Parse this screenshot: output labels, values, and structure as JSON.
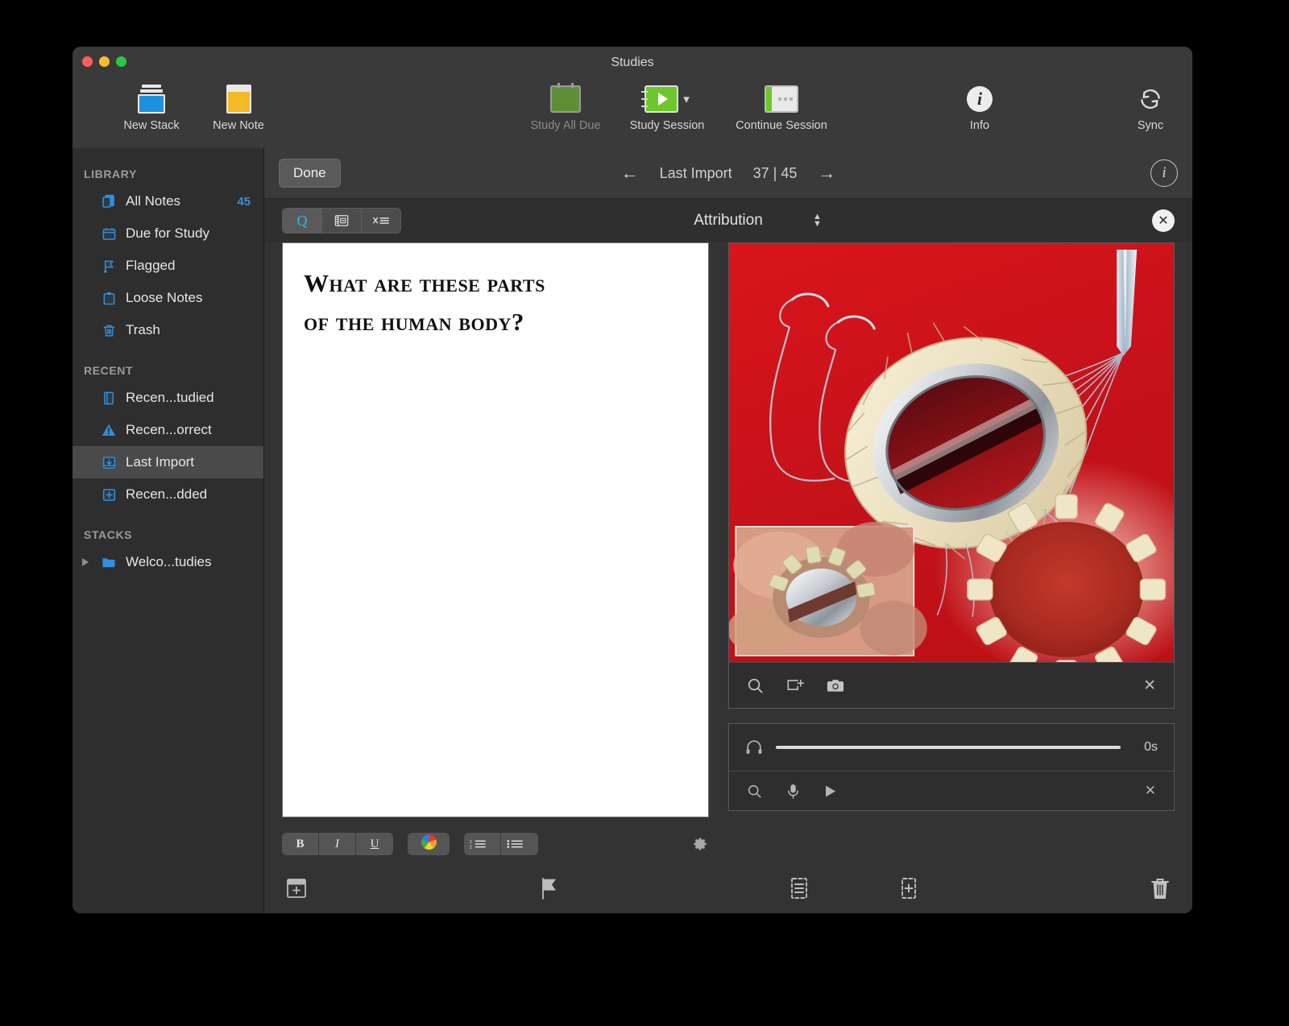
{
  "window": {
    "title": "Studies"
  },
  "toolbar": {
    "items": [
      {
        "label": "New Stack",
        "icon": "new-stack-icon",
        "dim": false
      },
      {
        "label": "New Note",
        "icon": "new-note-icon",
        "dim": false
      },
      {
        "label": "Study All Due",
        "icon": "calendar-icon",
        "dim": true
      },
      {
        "label": "Study Session",
        "icon": "play-notebook-icon",
        "dim": false
      },
      {
        "label": "Continue Session",
        "icon": "continue-notebook-icon",
        "dim": false
      },
      {
        "label": "Info",
        "icon": "info-circle-icon",
        "dim": false
      },
      {
        "label": "Sync",
        "icon": "sync-icon",
        "dim": false
      }
    ]
  },
  "sidebar": {
    "sections": [
      {
        "title": "LIBRARY",
        "items": [
          {
            "label": "All Notes",
            "icon": "notes-icon",
            "count": "45",
            "selected": false
          },
          {
            "label": "Due for Study",
            "icon": "calendar-icon",
            "count": "",
            "selected": false
          },
          {
            "label": "Flagged",
            "icon": "flag-icon",
            "count": "",
            "selected": false
          },
          {
            "label": "Loose Notes",
            "icon": "clipboard-icon",
            "count": "",
            "selected": false
          },
          {
            "label": "Trash",
            "icon": "trash-icon",
            "count": "",
            "selected": false
          }
        ]
      },
      {
        "title": "RECENT",
        "items": [
          {
            "label": "Recen...tudied",
            "icon": "recently-studied-icon",
            "count": "",
            "selected": false
          },
          {
            "label": "Recen...orrect",
            "icon": "warning-triangle-icon",
            "count": "",
            "selected": false
          },
          {
            "label": "Last Import",
            "icon": "import-icon",
            "count": "",
            "selected": true
          },
          {
            "label": "Recen...dded",
            "icon": "plus-box-icon",
            "count": "",
            "selected": false
          }
        ]
      },
      {
        "title": "STACKS",
        "items": [
          {
            "label": "Welco...tudies",
            "icon": "folder-icon",
            "count": "",
            "selected": false,
            "disclosure": true
          }
        ]
      }
    ]
  },
  "navbar": {
    "done_label": "Done",
    "prev_arrow": "←",
    "next_arrow": "→",
    "source_label": "Last Import",
    "position": "37 | 45",
    "info_glyph": "i"
  },
  "attribution": {
    "segments": [
      {
        "label": "Q",
        "name": "question-tab",
        "active": true
      },
      {
        "label": "",
        "name": "card-layout-tab",
        "active": false
      },
      {
        "label": "",
        "name": "multiply-list-tab",
        "active": false
      }
    ],
    "title": "Attribution",
    "close_glyph": "✕"
  },
  "card": {
    "text_line1": "What are these parts",
    "text_line2": "of the human body?",
    "format_buttons": [
      {
        "label": "B",
        "name": "bold-button"
      },
      {
        "label": "I",
        "name": "italic-button"
      },
      {
        "label": "U",
        "name": "underline-button"
      }
    ],
    "color_button": "color-wheel-button",
    "list_buttons": [
      {
        "name": "numbered-list-button"
      },
      {
        "name": "bulleted-list-button"
      }
    ],
    "gear": "gear-icon"
  },
  "media": {
    "image_alt": "Medical illustration of prosthetic heart valve ring with sutures",
    "tools": [
      {
        "name": "search-image-icon"
      },
      {
        "name": "add-image-icon"
      },
      {
        "name": "camera-icon"
      },
      {
        "name": "remove-image-icon"
      }
    ]
  },
  "audio": {
    "headphone_icon": "headphones-icon",
    "duration": "0s",
    "tools": [
      {
        "name": "search-audio-icon"
      },
      {
        "name": "microphone-icon"
      },
      {
        "name": "play-icon"
      },
      {
        "name": "remove-audio-icon"
      }
    ]
  },
  "bottombar": {
    "items": [
      {
        "name": "add-note-button"
      },
      {
        "name": "flag-button"
      },
      {
        "name": "card-list-button"
      },
      {
        "name": "add-card-button"
      },
      {
        "name": "delete-button"
      }
    ]
  }
}
